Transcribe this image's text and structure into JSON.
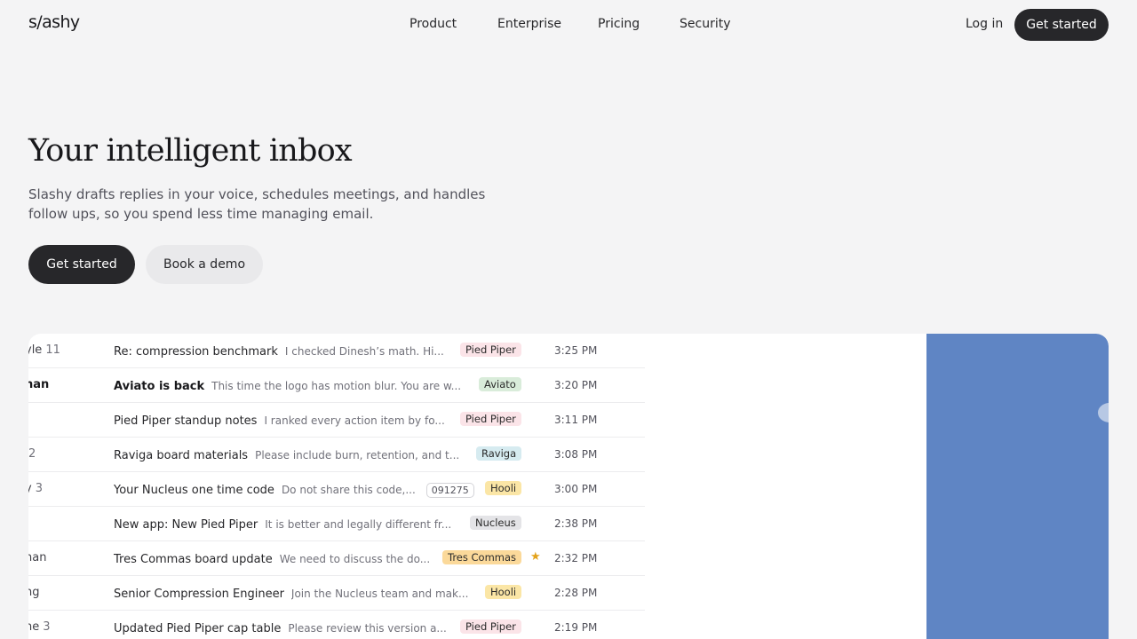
{
  "nav": {
    "logo": "s/ashy",
    "links": [
      "Product",
      "Enterprise",
      "Pricing",
      "Security"
    ],
    "login": "Log in",
    "cta": "Get started"
  },
  "hero": {
    "title": "Your intelligent inbox",
    "subtitle": "Slashy drafts replies in your voice, schedules meetings, and handles follow ups, so you spend less time managing email.",
    "primary_button": "Get started",
    "secondary_button": "Book a demo"
  },
  "emails": [
    {
      "sender": "yle",
      "count": "11",
      "subject": "Re: compression benchmark",
      "snippet": "I checked Dinesh’s math. Hi...",
      "tag": "Pied Piper",
      "time": "3:25 PM",
      "unread": false
    },
    {
      "sender": "nan",
      "count": "",
      "subject": "Aviato is back",
      "snippet": "This time the logo has motion blur. You are w...",
      "tag": "Aviato",
      "time": "3:20 PM",
      "unread": true
    },
    {
      "sender": "",
      "count": "",
      "subject": "Pied Piper standup notes",
      "snippet": "I ranked every action item by fo...",
      "tag": "Pied Piper",
      "time": "3:11 PM",
      "unread": false
    },
    {
      "sender": "",
      "count": "2",
      "subject": "Raviga board materials",
      "snippet": "Please include burn, retention, and t...",
      "tag": "Raviga",
      "time": "3:08 PM",
      "unread": false
    },
    {
      "sender": "y",
      "count": "3",
      "subject": "Your Nucleus one time code",
      "snippet": "Do not share this code,...",
      "code": "091275",
      "tag": "Hooli",
      "time": "3:00 PM",
      "unread": false
    },
    {
      "sender": "",
      "count": "",
      "subject": "New app: New Pied Piper",
      "snippet": "It is better and legally different fr...",
      "tag": "Nucleus",
      "time": "2:38 PM",
      "unread": false
    },
    {
      "sender": "nan",
      "count": "",
      "subject": "Tres Commas board update",
      "snippet": "We need to discuss the do...",
      "tag": "Tres Commas",
      "time": "2:32 PM",
      "unread": false,
      "starred": true
    },
    {
      "sender": "ng",
      "count": "",
      "subject": "Senior Compression Engineer",
      "snippet": "Join the Nucleus team and mak...",
      "tag": "Hooli",
      "time": "2:28 PM",
      "unread": false
    },
    {
      "sender": "ne",
      "count": "3",
      "subject": "Updated Pied Piper cap table",
      "snippet": "Please review this version a...",
      "tag": "Pied Piper",
      "time": "2:19 PM",
      "unread": false
    }
  ],
  "colors": {
    "accent_dark": "#27272a",
    "background": "#f4f4f5",
    "preview_blue": "#5f85c4",
    "star": "#e3a21a"
  }
}
